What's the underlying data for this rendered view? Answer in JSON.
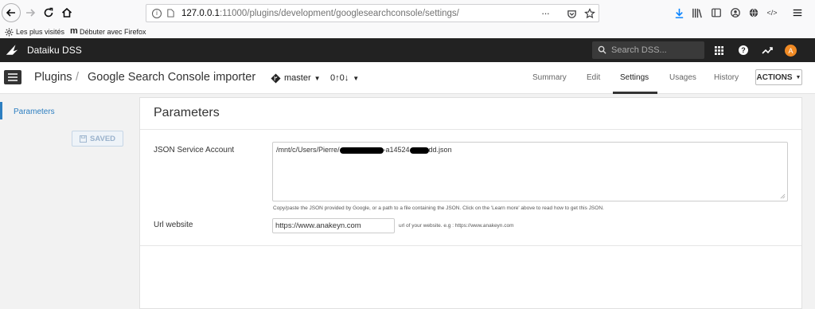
{
  "browser": {
    "url_prefix": "127.0.0.1",
    "url_rest": ":11000/plugins/development/googlesearchconsole/settings/",
    "bookmarks": [
      "Les plus visités",
      "Débuter avec Firefox"
    ]
  },
  "dss": {
    "brand": "Dataiku DSS",
    "search_placeholder": "Search DSS...",
    "avatar_letter": "A",
    "accent_color": "#f08a24"
  },
  "header": {
    "crumb_root": "Plugins",
    "separator": "/",
    "crumb_current": "Google Search Console importer",
    "branch": "master",
    "commits_ahead": "0",
    "commits_behind": "0",
    "tabs": [
      "Summary",
      "Edit",
      "Settings",
      "Usages",
      "History"
    ],
    "actions_label": "ACTIONS"
  },
  "sidebar": {
    "items": [
      {
        "label": "Parameters"
      }
    ],
    "saved_label": "SAVED"
  },
  "panel": {
    "title": "Parameters",
    "json_label": "JSON Service Account",
    "json_value_a": "/mnt/c/Users/Pierre/",
    "json_value_b": "-a14524",
    "json_value_c": "dd.json",
    "json_help": "Copy/paste the JSON provided by Google, or a path to a file containing the JSON. Click on the 'Learn more' above to read how to get this JSON.",
    "url_label": "Url website",
    "url_value": "https://www.anakeyn.com",
    "url_help": "url of your website. e.g : https://www.anakeyn.com"
  }
}
